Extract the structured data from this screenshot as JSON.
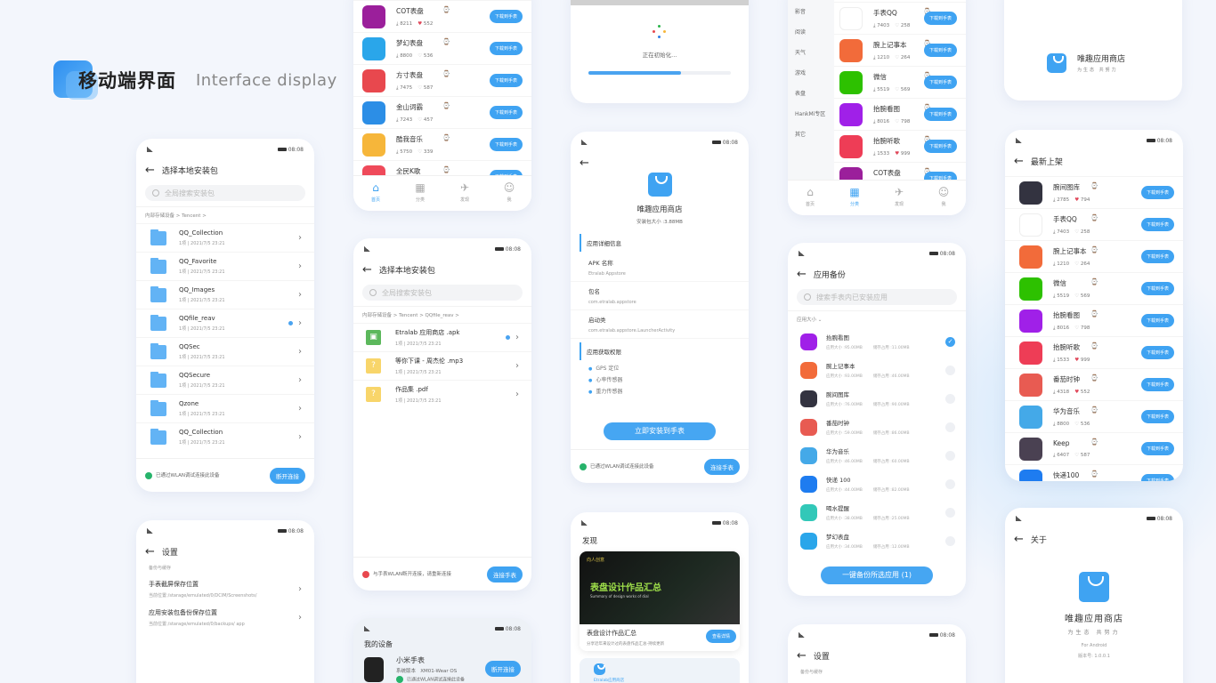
{
  "hero": {
    "title_cn": "移动端界面",
    "title_en": "Interface display"
  },
  "status": {
    "time": "08:08"
  },
  "screen_local": {
    "title": "选择本地安装包",
    "search_placeholder": "全局搜索安装包",
    "crumb": "内部存储设备 > Tencent >",
    "folders": [
      {
        "name": "QQ_Collection",
        "meta": "1项  |  2021/7/5 23:21"
      },
      {
        "name": "QQ_Favorite",
        "meta": "1项  |  2021/7/5 23:21"
      },
      {
        "name": "QQ_Images",
        "meta": "1项  |  2021/7/5 23:21"
      },
      {
        "name": "QQfile_reav",
        "meta": "1项  |  2021/7/5 23:21"
      },
      {
        "name": "QQSec",
        "meta": "1项  |  2021/7/5 23:21"
      },
      {
        "name": "QQSecure",
        "meta": "1项  |  2021/7/5 23:21"
      },
      {
        "name": "Qzone",
        "meta": "1项  |  2021/7/5 23:21"
      },
      {
        "name": "QQ_Collection",
        "meta": "1项  |  2021/7/5 23:21"
      }
    ],
    "footer_status": "已通过WLAN调试连接此设备",
    "footer_button": "断开连接"
  },
  "screen_settings": {
    "title": "设置",
    "section": "备份与缓存",
    "items": [
      {
        "title": "手表截屏保存位置",
        "sub": "当前位置:/starage/emulated/0/DCIM/Screenshots/"
      },
      {
        "title": "应用安装包备份保存位置",
        "sub": "当前位置:/starage/emulated/0/backups/ app"
      }
    ]
  },
  "screen_home": {
    "apps": [
      {
        "name": "COT表盘",
        "downloads": "8211",
        "likes": "552",
        "liked": true,
        "color": "#9b1f9b"
      },
      {
        "name": "梦幻表盘",
        "downloads": "8800",
        "likes": "536",
        "liked": false,
        "color": "#2aa6ea"
      },
      {
        "name": "方寸表盘",
        "downloads": "7475",
        "likes": "587",
        "liked": false,
        "color": "#e8484e"
      },
      {
        "name": "金山词霸",
        "downloads": "7243",
        "likes": "457",
        "liked": false,
        "color": "#2c8ee6"
      },
      {
        "name": "酷我音乐",
        "downloads": "5750",
        "likes": "339",
        "liked": false,
        "color": "#f6b63a"
      },
      {
        "name": "全民K歌",
        "downloads": "",
        "likes": "",
        "liked": false,
        "color": "#ef4a5a"
      }
    ],
    "download_label": "下载到手表",
    "tabs": [
      "首页",
      "分类",
      "发现",
      "我"
    ]
  },
  "screen_local2": {
    "title": "选择本地安装包",
    "search_placeholder": "全局搜索安装包",
    "crumb": "内部存储设备 > Tencent > QQfile_reav >",
    "files": [
      {
        "name": "Etralab 应用商店 .apk",
        "meta": "1项  |  2021/7/5 23:21",
        "type": "apk"
      },
      {
        "name": "等你下课 - 周杰伦 .mp3",
        "meta": "1项  |  2021/7/5 23:21",
        "type": "unknown"
      },
      {
        "name": "作品集 .pdf",
        "meta": "1项  |  2021/7/5 23:21",
        "type": "unknown"
      }
    ],
    "footer_status": "与手表WLAN断开连接，请重新连接",
    "footer_button": "连接手表"
  },
  "screen_device": {
    "title": "我的设备",
    "device_name": "小米手表",
    "sys_label": "系统版本",
    "sys_value": "XM01-Wear OS",
    "status": "已通过WLAN调试连接此设备",
    "button": "断开连接"
  },
  "screen_init": {
    "text": "正在初始化...",
    "progress": 0.65
  },
  "screen_detail": {
    "app_name": "唯趣应用商店",
    "size": "安装包大小 :3.88MB",
    "section1": "应用详细信息",
    "fields": [
      {
        "k": "APK 名称",
        "v": "Etralab Appstore"
      },
      {
        "k": "包名",
        "v": "com.etralab.appstore"
      },
      {
        "k": "启动类",
        "v": "com.etralab.appstore.LauncherActivity"
      }
    ],
    "section2": "应用获取权限",
    "perms": [
      "GPS 定位",
      "心率传感器",
      "重力传感器"
    ],
    "install_button": "立即安装到手表",
    "footer_status": "已通过WLAN调试连接此设备",
    "footer_button": "连接手表"
  },
  "screen_discover": {
    "title": "发现",
    "banner_title": "表盘设计作品汇总",
    "banner_sub": "Summary of design works of dial",
    "banner_brand": "向人创意",
    "card_title": "表盘设计作品汇总",
    "card_sub": "分享近年来设计过的表盘作品汇总-持续更新",
    "card_button": "查看详情",
    "next_label": "Etralab应用商店"
  },
  "screen_category": {
    "categories": [
      "影音",
      "阅读",
      "天气",
      "游戏",
      "表盘",
      "HankMi专区",
      "其它"
    ],
    "apps": [
      {
        "name": "手表QQ",
        "downloads": "7403",
        "likes": "258",
        "liked": false,
        "color": "#ffffff"
      },
      {
        "name": "腕上记事本",
        "downloads": "1210",
        "likes": "264",
        "liked": false,
        "color": "#f26b3a"
      },
      {
        "name": "微信",
        "downloads": "5519",
        "likes": "569",
        "liked": false,
        "color": "#2dc100"
      },
      {
        "name": "抬腕看图",
        "downloads": "8016",
        "likes": "798",
        "liked": false,
        "color": "#a020e8"
      },
      {
        "name": "抬腕听歌",
        "downloads": "1533",
        "likes": "999",
        "liked": true,
        "color": "#ee3d56"
      },
      {
        "name": "COT表盘",
        "downloads": "",
        "likes": "",
        "liked": false,
        "color": "#9b1f9b"
      }
    ],
    "download_label": "下载到手表",
    "tabs": [
      "首页",
      "分类",
      "发现",
      "我"
    ]
  },
  "screen_backup": {
    "title": "应用备份",
    "search_placeholder": "搜索手表内已安装应用",
    "sort_label": "应用大小",
    "apps": [
      {
        "name": "抬腕看图",
        "size": "应用大小 :95.00MB",
        "cache": "储存占用 :11.00MB",
        "checked": true,
        "color": "#a020e8"
      },
      {
        "name": "腕上记事本",
        "size": "应用大小 :93.00MB",
        "cache": "储存占用 :46.00MB",
        "checked": false,
        "color": "#f26b3a"
      },
      {
        "name": "腕间图库",
        "size": "应用大小 :76.00MB",
        "cache": "储存占用 :90.00MB",
        "checked": false,
        "color": "#333340"
      },
      {
        "name": "番茄时钟",
        "size": "应用大小 :59.00MB",
        "cache": "储存占用 :86.00MB",
        "checked": false,
        "color": "#e85b52"
      },
      {
        "name": "华为音乐",
        "size": "应用大小 :46.00MB",
        "cache": "储存占用 :60.00MB",
        "checked": false,
        "color": "#44a9e8"
      },
      {
        "name": "快递 100",
        "size": "应用大小 :44.00MB",
        "cache": "储存占用 :82.00MB",
        "checked": false,
        "color": "#1e7cf0"
      },
      {
        "name": "喝水提醒",
        "size": "应用大小 :38.00MB",
        "cache": "储存占用 :25.00MB",
        "checked": false,
        "color": "#32c8b8"
      },
      {
        "name": "梦幻表盘",
        "size": "应用大小 :34.00MB",
        "cache": "储存占用 :12.00MB",
        "checked": false,
        "color": "#2aa6ea"
      }
    ],
    "backup_button": "一键备份所选应用 (1)"
  },
  "screen_settings2": {
    "title": "设置",
    "section": "备份与缓存"
  },
  "screen_splash": {
    "app_name": "唯趣应用商店",
    "slogan": "为生态  共努力"
  },
  "screen_new": {
    "title": "最新上架",
    "apps": [
      {
        "name": "腕间图库",
        "downloads": "2785",
        "likes": "794",
        "liked": true,
        "color": "#333340"
      },
      {
        "name": "手表QQ",
        "downloads": "7403",
        "likes": "258",
        "liked": false,
        "color": "#ffffff"
      },
      {
        "name": "腕上记事本",
        "downloads": "1210",
        "likes": "264",
        "liked": false,
        "color": "#f26b3a"
      },
      {
        "name": "微信",
        "downloads": "5519",
        "likes": "569",
        "liked": false,
        "color": "#2dc100"
      },
      {
        "name": "抬腕看图",
        "downloads": "8016",
        "likes": "798",
        "liked": false,
        "color": "#a020e8"
      },
      {
        "name": "抬腕听歌",
        "downloads": "1533",
        "likes": "999",
        "liked": true,
        "color": "#ee3d56"
      },
      {
        "name": "番茄时钟",
        "downloads": "4318",
        "likes": "552",
        "liked": true,
        "color": "#e85b52"
      },
      {
        "name": "华为音乐",
        "downloads": "8800",
        "likes": "536",
        "liked": false,
        "color": "#44a9e8"
      },
      {
        "name": "Keep",
        "downloads": "6407",
        "likes": "587",
        "liked": false,
        "color": "#4a4152"
      },
      {
        "name": "快递100",
        "downloads": "",
        "likes": "",
        "liked": false,
        "color": "#1e7cf0"
      }
    ],
    "download_label": "下载到手表"
  },
  "screen_about": {
    "title": "关于",
    "app_name": "唯趣应用商店",
    "slogan": "为生态  共努力",
    "platform": "For Android",
    "version": "版本号: 1.0.0.1"
  }
}
